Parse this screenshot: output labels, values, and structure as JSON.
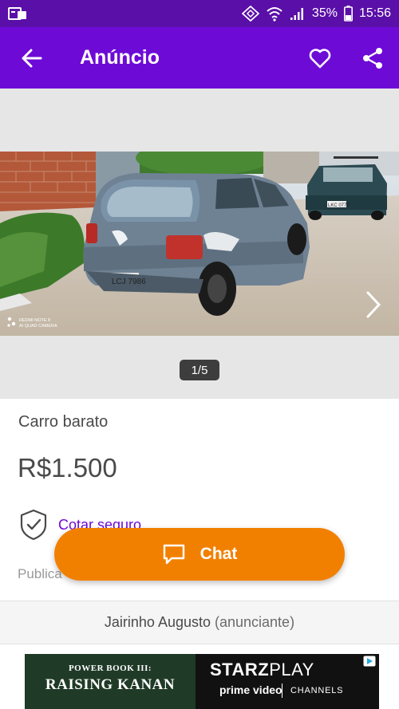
{
  "status_bar": {
    "battery": "35%",
    "time": "15:56"
  },
  "app_bar": {
    "title": "Anúncio"
  },
  "gallery": {
    "counter": "1/5",
    "watermark_line1": "REDMI NOTE 8",
    "watermark_line2": "AI QUAD CAMERA",
    "front_plate": "LCJ 7986",
    "rear_plate": "LKC 0770"
  },
  "listing": {
    "title": "Carro barato",
    "price": "R$1.500",
    "insurance_label": "Cotar seguro",
    "published_label": "Publica"
  },
  "chat_button": {
    "label": "Chat"
  },
  "seller": {
    "name": "Jairinho Augusto",
    "role": "(anunciante)"
  },
  "ad": {
    "left_top": "POWER BOOK III:",
    "left_main": "RAISING KANAN",
    "starz": "STARZ",
    "play": "PLAY",
    "prime": "prime video",
    "channels": "CHANNELS"
  },
  "colors": {
    "primary": "#6e0ad6",
    "status": "#5a0fa8",
    "accent": "#f28000"
  },
  "icons": [
    "sim-card-icon",
    "nfc-icon",
    "wifi-icon",
    "signal-icon",
    "battery-icon",
    "back-arrow-icon",
    "heart-icon",
    "share-icon",
    "chevron-right-icon",
    "shield-check-icon",
    "chat-bubble-icon",
    "adchoices-icon"
  ]
}
